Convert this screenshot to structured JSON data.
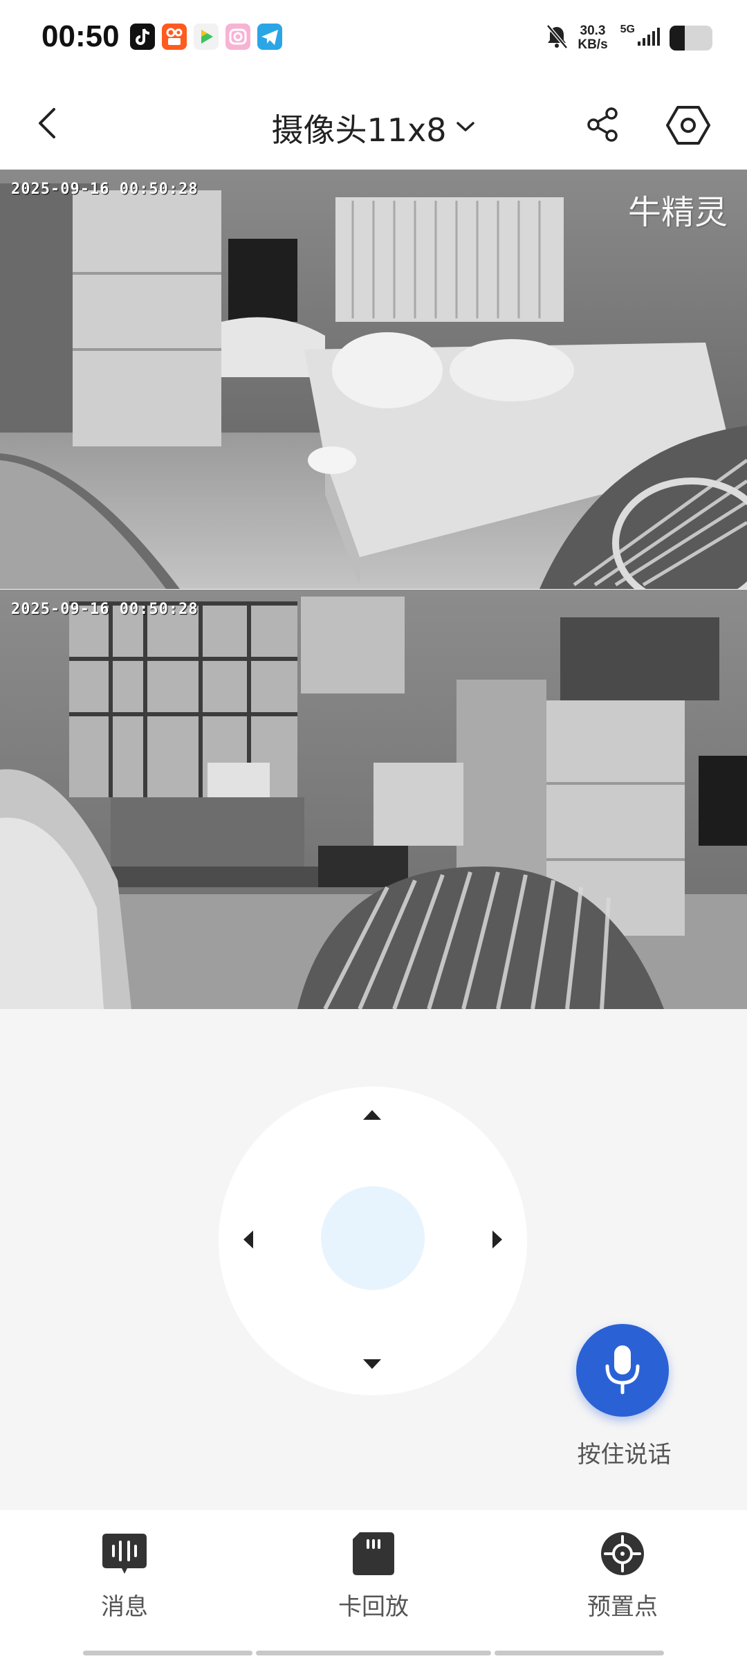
{
  "status_bar": {
    "time": "00:50",
    "apps": [
      {
        "icon": "tiktok-icon",
        "color": "#111111"
      },
      {
        "icon": "kuaishou-icon",
        "color": "#ff5a1f"
      },
      {
        "icon": "video-app-icon",
        "color": "#f2f2f2"
      },
      {
        "icon": "camera-app-icon",
        "color": "#f7b3d4"
      },
      {
        "icon": "telegram-icon",
        "color": "#2aa6e6"
      }
    ],
    "net_speed_value": "30.3",
    "net_speed_unit": "KB/s",
    "network_type": "5G",
    "battery_level": 0.35
  },
  "header": {
    "title": "摄像头11x8"
  },
  "feeds": [
    {
      "timestamp": "2025-09-16 00:50:28",
      "watermark": "牛精灵"
    },
    {
      "timestamp": "2025-09-16 00:50:28"
    }
  ],
  "talk": {
    "label": "按住说话",
    "color": "#2a62d6"
  },
  "bottom_nav": [
    {
      "label": "消息",
      "icon": "message-icon"
    },
    {
      "label": "卡回放",
      "icon": "sd-card-icon"
    },
    {
      "label": "预置点",
      "icon": "preset-point-icon"
    }
  ]
}
